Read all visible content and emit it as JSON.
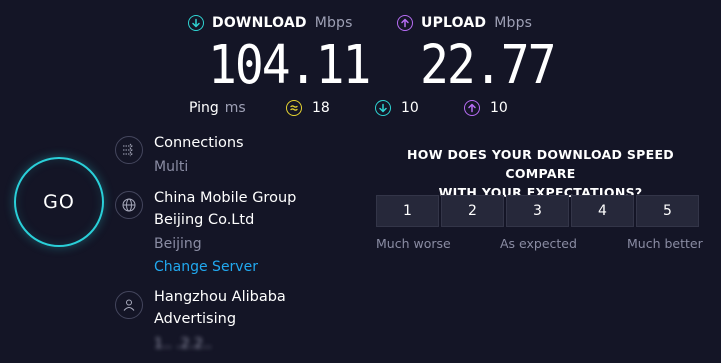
{
  "download": {
    "label": "DOWNLOAD",
    "unit": "Mbps",
    "value": "104.11",
    "icon": "arrow-down-circle-icon"
  },
  "upload": {
    "label": "UPLOAD",
    "unit": "Mbps",
    "value": "22.77",
    "icon": "arrow-up-circle-icon"
  },
  "ping": {
    "label": "Ping",
    "unit": "ms",
    "idle": "18",
    "download": "10",
    "upload": "10"
  },
  "go_button": {
    "label": "GO"
  },
  "connections": {
    "title": "Connections",
    "value": "Multi"
  },
  "isp": {
    "line1": "China Mobile Group",
    "line2": "Beijing Co.Ltd",
    "city": "Beijing",
    "change_link": "Change Server"
  },
  "host": {
    "line1": "Hangzhou Alibaba",
    "line2": "Advertising",
    "ip_blurred": "1.. .2.2.."
  },
  "survey": {
    "question_line1": "HOW DOES YOUR DOWNLOAD SPEED COMPARE",
    "question_line2": "WITH YOUR EXPECTATIONS?",
    "options": [
      "1",
      "2",
      "3",
      "4",
      "5"
    ],
    "label_low": "Much worse",
    "label_mid": "As expected",
    "label_high": "Much better"
  },
  "colors": {
    "background": "#141526",
    "accent_cyan": "#2fd3d2",
    "accent_purple": "#b66cf3",
    "accent_yellow": "#e6d431",
    "link_blue": "#21a8ef"
  }
}
